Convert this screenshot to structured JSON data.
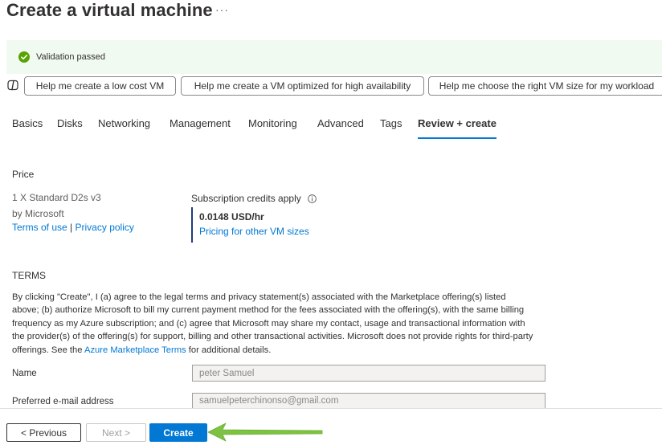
{
  "header": {
    "title": "Create a virtual machine",
    "more_label": "···"
  },
  "validation": {
    "icon": "check-circle-icon",
    "message": "Validation passed",
    "color": "#57a300"
  },
  "copilot": {
    "icon": "copilot-icon",
    "suggestions": [
      "Help me create a low cost VM",
      "Help me create a VM optimized for high availability",
      "Help me choose the right VM size for my workload"
    ]
  },
  "tabs": [
    {
      "label": "Basics"
    },
    {
      "label": "Disks"
    },
    {
      "label": "Networking"
    },
    {
      "label": "Management"
    },
    {
      "label": "Monitoring"
    },
    {
      "label": "Advanced"
    },
    {
      "label": "Tags"
    },
    {
      "label": "Review + create",
      "active": true
    }
  ],
  "price": {
    "section_label": "Price",
    "sku": "1 X Standard D2s v3",
    "vendor": "by Microsoft",
    "terms_link": "Terms of use",
    "separator": "|",
    "privacy_link": "Privacy policy",
    "credits_label": "Subscription credits apply",
    "credits_icon": "info-icon",
    "rate": "0.0148 USD/hr",
    "other_sizes_link": "Pricing for other VM sizes"
  },
  "terms": {
    "section_label": "TERMS",
    "text_before_link": "By clicking \"Create\", I (a) agree to the legal terms and privacy statement(s) associated with the Marketplace offering(s) listed above; (b) authorize Microsoft to bill my current payment method for the fees associated with the offering(s), with the same billing frequency as my Azure subscription; and (c) agree that Microsoft may share my contact, usage and transactional information with the provider(s) of the offering(s) for support, billing and other transactional activities. Microsoft does not provide rights for third-party offerings. See the ",
    "link_text": "Azure Marketplace Terms",
    "text_after_link": " for additional details."
  },
  "contact": {
    "name_label": "Name",
    "name_value": "peter Samuel",
    "email_label": "Preferred e-mail address",
    "email_value": "samuelpeterchinonso@gmail.com"
  },
  "footer": {
    "previous_label": "< Previous",
    "next_label": "Next >",
    "create_label": "Create"
  },
  "annotation": {
    "arrow_icon": "arrow-pointer-icon",
    "arrow_color": "#7dc242"
  },
  "colors": {
    "accent": "#0078d4",
    "link": "#0078d4",
    "validation_bg": "#f1faf0"
  }
}
